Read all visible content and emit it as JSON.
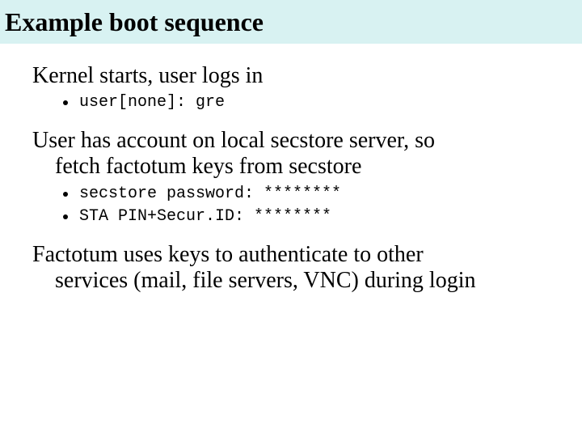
{
  "title": "Example boot sequence",
  "items": [
    {
      "text": "Kernel starts, user logs in",
      "sub": [
        {
          "code": "user[none]: gre"
        }
      ]
    },
    {
      "text": "User has account on local secstore server, so fetch factotum keys from secstore",
      "sub": [
        {
          "code": "secstore password: ********"
        },
        {
          "code": "STA PIN+Secur.ID: ********"
        }
      ]
    },
    {
      "text": "Factotum uses keys to authenticate to other services (mail, file servers, VNC) during login",
      "sub": []
    }
  ]
}
